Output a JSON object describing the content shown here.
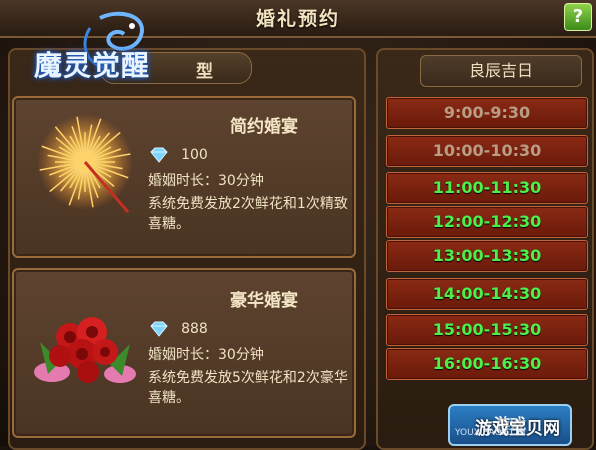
{
  "header": {
    "title": "婚礼预约",
    "help_label": "?"
  },
  "logo": {
    "text": "魔灵觉醒"
  },
  "left": {
    "type_tail": "型",
    "cards": [
      {
        "title": "简约婚宴",
        "price": "100",
        "duration": "婚姻时长：30分钟",
        "desc": "系统免费发放2次鲜花和1次精致喜糖。",
        "art_icon": "firework-icon"
      },
      {
        "title": "豪华婚宴",
        "price": "888",
        "duration": "婚姻时长：30分钟",
        "desc": "系统免费发放5次鲜花和2次豪华喜糖。",
        "art_icon": "rose-bouquet-icon"
      }
    ]
  },
  "right": {
    "day_header": "良辰吉日",
    "slots": [
      {
        "time": "9:00-9:30",
        "state": "past"
      },
      {
        "time": "10:00-10:30",
        "state": "past"
      },
      {
        "time": "11:00-11:30",
        "state": "open"
      },
      {
        "time": "12:00-12:30",
        "state": "open"
      },
      {
        "time": "13:00-13:30",
        "state": "open"
      },
      {
        "time": "14:00-14:30",
        "state": "open"
      },
      {
        "time": "15:00-15:30",
        "state": "open"
      },
      {
        "time": "16:00-16:30",
        "state": "open"
      }
    ]
  },
  "bottom_button": {
    "label": "游戏"
  },
  "watermark": {
    "big": "游戏宝贝网",
    "small": "YOUXIBAO.COM"
  },
  "colors": {
    "open": "#4cf04a",
    "past": "#b89c84",
    "slot_bg": "#7a2210"
  }
}
